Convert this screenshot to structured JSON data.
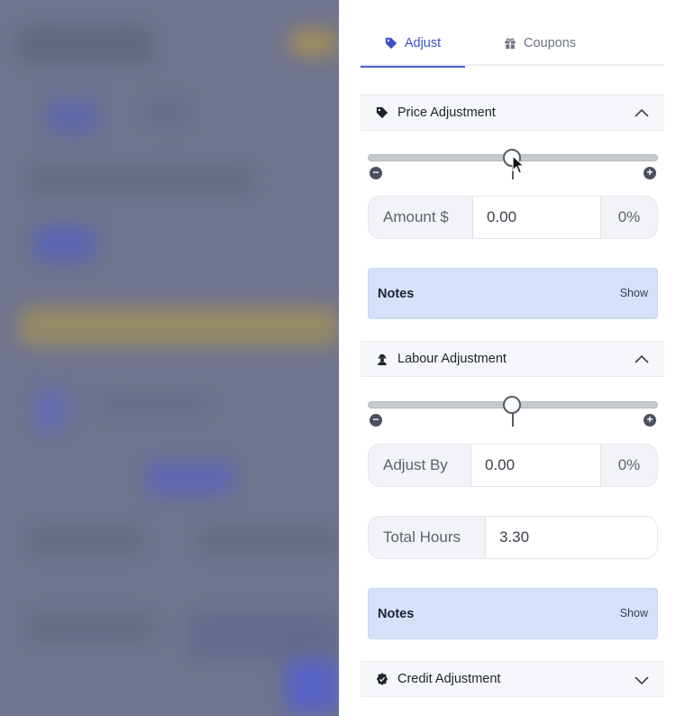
{
  "tabs": {
    "adjust_label": "Adjust",
    "coupons_label": "Coupons"
  },
  "price_adjustment": {
    "title": "Price Adjustment",
    "slider_level": 0.5,
    "amount_label": "Amount $",
    "amount_value": "0.00",
    "percent": "0%",
    "notes_label": "Notes",
    "notes_toggle": "Show"
  },
  "labour_adjustment": {
    "title": "Labour Adjustment",
    "slider_level": 0.5,
    "adjust_label": "Adjust By",
    "adjust_value": "0.00",
    "percent": "0%",
    "total_hours_label": "Total Hours",
    "total_hours_value": "3.30",
    "notes_label": "Notes",
    "notes_toggle": "Show"
  },
  "credit_adjustment": {
    "title": "Credit Adjustment"
  },
  "icons": {
    "adjust_tab": "tag-icon",
    "coupons_tab": "gift-icon",
    "price": "tag-icon",
    "labour": "worker-icon",
    "credit": "badge-icon"
  },
  "colors": {
    "accent": "#3d4fc8",
    "notes_bg": "#d5e1f9",
    "overlay": "#6b6f88"
  }
}
